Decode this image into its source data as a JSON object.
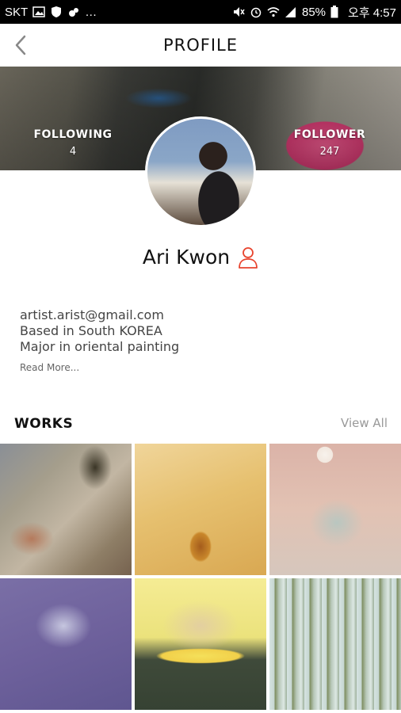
{
  "status_bar": {
    "carrier": "SKT",
    "battery": "85%",
    "time": "오후 4:57"
  },
  "header": {
    "title": "PROFILE"
  },
  "stats": {
    "following_label": "FOLLOWING",
    "following_count": "4",
    "follower_label": "FOLLOWER",
    "follower_count": "247"
  },
  "profile": {
    "name": "Ari Kwon",
    "bio": [
      "artist.arist@gmail.com",
      "Based in South KOREA",
      "Major in oriental painting"
    ],
    "read_more": "Read More..."
  },
  "works": {
    "title": "WORKS",
    "view_all": "View All"
  },
  "colors": {
    "accent": "#e8442e",
    "status_bar_bg": "#000000"
  }
}
